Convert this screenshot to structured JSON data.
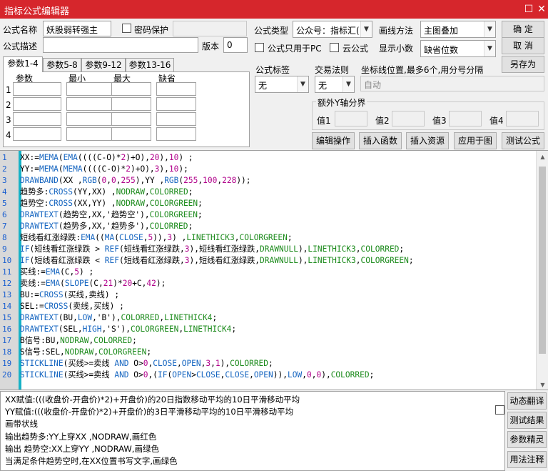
{
  "window": {
    "title": "指标公式编辑器",
    "maximize_glyph": "☐",
    "close_glyph": "✕"
  },
  "form": {
    "name_label": "公式名称",
    "name_value": "妖股弱转强主",
    "password_label": "密码保护",
    "desc_label": "公式描述",
    "desc_value": "",
    "version_label": "版本",
    "version_value": "0",
    "type_label": "公式类型",
    "type_value": "公众号：指标汇(",
    "draw_method_label": "画线方法",
    "draw_method_value": "主图叠加",
    "pc_only_label": "公式只用于PC",
    "cloud_label": "云公式",
    "decimal_label": "显示小数",
    "decimal_value": "缺省位数",
    "formula_tag_label": "公式标签",
    "formula_tag_value": "无",
    "trade_rule_label": "交易法则",
    "trade_rule_value": "无",
    "coord_label": "坐标线位置,最多6个,用分号分隔",
    "coord_value": "自动",
    "extra_y_label": "额外Y轴分界",
    "extra_y": [
      "值1",
      "值2",
      "值3",
      "值4"
    ]
  },
  "buttons": {
    "ok": "确  定",
    "cancel": "取  消",
    "save_as": "另存为",
    "edit_ops": "编辑操作",
    "insert_func": "插入函数",
    "insert_res": "插入资源",
    "apply_chart": "应用于图",
    "test_formula": "测试公式"
  },
  "params": {
    "tabs": [
      "参数1-4",
      "参数5-8",
      "参数9-12",
      "参数13-16"
    ],
    "headers": [
      "参数",
      "最小",
      "最大",
      "缺省"
    ],
    "rows": [
      "1",
      "2",
      "3",
      "4"
    ]
  },
  "code_lines": [
    "XX:=MEMA(EMA((((C-O)*2)+O),20),10) ;",
    "YY:=MEMA(MEMA((((C-O)*2)+O),3),10);",
    "DRAWBAND(XX ,RGB(0,0,255),YY ,RGB(255,100,228));",
    "趋势多:CROSS(YY,XX) ,NODRAW,COLORRED;",
    "趋势空:CROSS(XX,YY) ,NODRAW,COLORGREEN;",
    "DRAWTEXT(趋势空,XX,'趋势空'),COLORGREEN;",
    "DRAWTEXT(趋势多,XX,'趋势多'),COLORRED;",
    "短线看红涨绿跌:EMA((MA(CLOSE,5)),3) ,LINETHICK3,COLORGREEN;",
    "IF(短线看红涨绿跌 > REF(短线看红涨绿跌,3),短线看红涨绿跌,DRAWNULL),LINETHICK3,COLORRED;",
    "IF(短线看红涨绿跌 < REF(短线看红涨绿跌,3),短线看红涨绿跌,DRAWNULL),LINETHICK3,COLORGREEN;",
    "买线:=EMA(C,5) ;",
    "卖线:=EMA(SLOPE(C,21)*20+C,42);",
    "BU:=CROSS(买线,卖线) ;",
    "SEL:=CROSS(卖线,买线) ;",
    "DRAWTEXT(BU,LOW,'B'),COLORRED,LINETHICK4;",
    "DRAWTEXT(SEL,HIGH,'S'),COLORGREEN,LINETHICK4;",
    "B信号:BU,NODRAW,COLORRED;",
    "S信号:SEL,NODRAW,COLORGREEN;",
    "STICKLINE(买线>=卖线 AND O>0,CLOSE,OPEN,3,1),COLORRED;",
    "STICKLINE(买线>=卖线 AND O>0,(IF(OPEN>CLOSE,CLOSE,OPEN)),LOW,0,0),COLORRED;"
  ],
  "notes": [
    "XX赋值:(((收盘价-开盘价)*2)+开盘价)的20日指数移动平均的10日平滑移动平均",
    "YY赋值:(((收盘价-开盘价)*2)+开盘价)的3日平滑移动平均的10日平滑移动平均",
    "画带状线",
    "输出趋势多:YY上穿XX ,NODRAW,画红色",
    "输出 趋势空:XX上穿YY ,NODRAW,画绿色",
    "当满足条件趋势空时,在XX位置书写文字,画绿色"
  ],
  "side_buttons": [
    "动态翻译",
    "测试结果",
    "参数精灵",
    "用法注释"
  ]
}
